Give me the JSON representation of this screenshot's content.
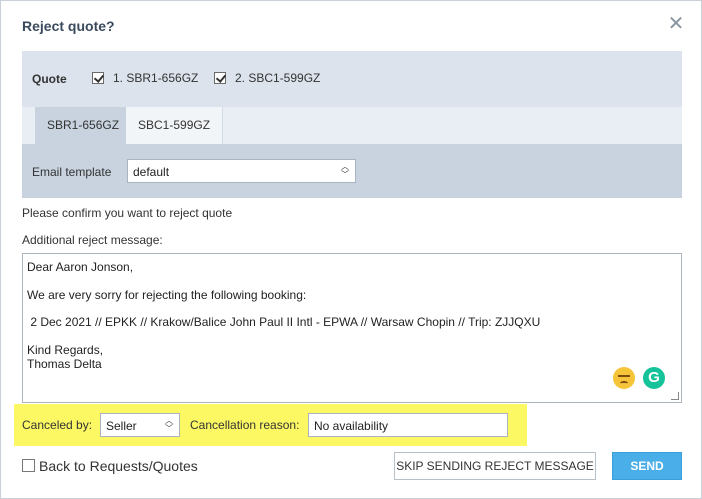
{
  "dialog": {
    "title": "Reject quote?",
    "close_icon": "close-icon"
  },
  "quote_bar": {
    "label": "Quote",
    "options": [
      {
        "label": "1. SBR1-656GZ",
        "checked": true
      },
      {
        "label": "2. SBC1-599GZ",
        "checked": true
      }
    ]
  },
  "tabs": [
    {
      "label": "SBR1-656GZ",
      "active": true
    },
    {
      "label": "SBC1-599GZ",
      "active": false
    }
  ],
  "email_template": {
    "label": "Email template",
    "value": "default"
  },
  "confirm_text": "Please confirm you want to reject quote",
  "message": {
    "label": "Additional reject message:",
    "lines": [
      "Dear Aaron Jonson,",
      "",
      "We are very sorry for rejecting the following booking:",
      "",
      " 2 Dec 2021 // EPKK // Krakow/Balice John Paul II Intl - EPWA // Warsaw Chopin // Trip: ZJJQXU",
      "",
      "Kind Regards,",
      "Thomas Delta"
    ]
  },
  "cancellation": {
    "canceled_by_label": "Canceled by:",
    "canceled_by_value": "Seller",
    "reason_label": "Cancellation reason:",
    "reason_value": "No availability",
    "highlight_color": "#fbf863"
  },
  "footer": {
    "back_label": "Back to Requests/Quotes",
    "back_checked": false,
    "skip_button": "SKIP SENDING REJECT MESSAGE",
    "send_button": "SEND",
    "send_color": "#4aaee8"
  }
}
